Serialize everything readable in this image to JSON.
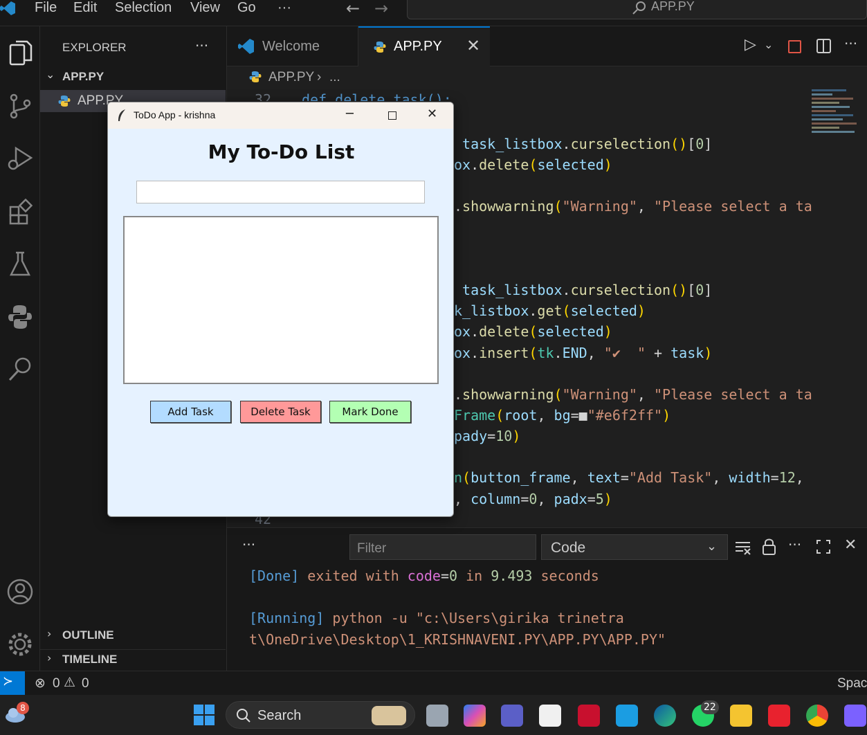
{
  "menu": {
    "file": "File",
    "edit": "Edit",
    "selection": "Selection",
    "view": "View",
    "go": "Go",
    "more": "···"
  },
  "search": {
    "label": "APP.PY"
  },
  "sidebar": {
    "title": "EXPLORER",
    "more": "···",
    "folder": "APP.PY",
    "file": "APP.PY",
    "outline": "OUTLINE",
    "timeline": "TIMELINE"
  },
  "tabs": {
    "welcome": "Welcome",
    "active": "APP.PY"
  },
  "breadcrumb": {
    "file": "APP.PY",
    "rest": "..."
  },
  "editor": {
    "line_top_num": "32",
    "line_top_text": "def delete_task():",
    "line_bottom_num": "42",
    "lines": [
      {
        "parts": [
          [
            "v",
            " task_listbox"
          ],
          [
            "p",
            "."
          ],
          [
            "f",
            "curselection"
          ],
          [
            "y",
            "()"
          ],
          [
            "p",
            "["
          ],
          [
            "n",
            "0"
          ],
          [
            "p",
            "]"
          ]
        ]
      },
      {
        "parts": [
          [
            "v",
            "ox"
          ],
          [
            "p",
            "."
          ],
          [
            "f",
            "delete"
          ],
          [
            "y",
            "("
          ],
          [
            "v",
            "selected"
          ],
          [
            "y",
            ")"
          ]
        ]
      },
      {
        "parts": []
      },
      {
        "parts": [
          [
            "p",
            "."
          ],
          [
            "f",
            "showwarning"
          ],
          [
            "y",
            "("
          ],
          [
            "s",
            "\"Warning\""
          ],
          [
            "p",
            ", "
          ],
          [
            "s",
            "\"Please select a ta"
          ]
        ]
      },
      {
        "parts": []
      },
      {
        "parts": []
      },
      {
        "parts": []
      },
      {
        "parts": [
          [
            "v",
            " task_listbox"
          ],
          [
            "p",
            "."
          ],
          [
            "f",
            "curselection"
          ],
          [
            "y",
            "()"
          ],
          [
            "p",
            "["
          ],
          [
            "n",
            "0"
          ],
          [
            "p",
            "]"
          ]
        ]
      },
      {
        "parts": [
          [
            "v",
            "k_listbox"
          ],
          [
            "p",
            "."
          ],
          [
            "f",
            "get"
          ],
          [
            "y",
            "("
          ],
          [
            "v",
            "selected"
          ],
          [
            "y",
            ")"
          ]
        ]
      },
      {
        "parts": [
          [
            "v",
            "ox"
          ],
          [
            "p",
            "."
          ],
          [
            "f",
            "delete"
          ],
          [
            "y",
            "("
          ],
          [
            "v",
            "selected"
          ],
          [
            "y",
            ")"
          ]
        ]
      },
      {
        "parts": [
          [
            "v",
            "ox"
          ],
          [
            "p",
            "."
          ],
          [
            "f",
            "insert"
          ],
          [
            "y",
            "("
          ],
          [
            "t",
            "tk"
          ],
          [
            "p",
            "."
          ],
          [
            "v",
            "END"
          ],
          [
            "p",
            ", "
          ],
          [
            "s",
            "\"✔  \""
          ],
          [
            "p",
            " + "
          ],
          [
            "v",
            "task"
          ],
          [
            "y",
            ")"
          ]
        ]
      },
      {
        "parts": []
      },
      {
        "parts": [
          [
            "p",
            "."
          ],
          [
            "f",
            "showwarning"
          ],
          [
            "y",
            "("
          ],
          [
            "s",
            "\"Warning\""
          ],
          [
            "p",
            ", "
          ],
          [
            "s",
            "\"Please select a ta"
          ]
        ]
      },
      {
        "parts": [
          [
            "t",
            "Frame"
          ],
          [
            "y",
            "("
          ],
          [
            "v",
            "root"
          ],
          [
            "p",
            ", "
          ],
          [
            "v",
            "bg"
          ],
          [
            "p",
            "="
          ],
          [
            "p",
            "■"
          ],
          [
            "s",
            "\"#e6f2ff\""
          ],
          [
            "y",
            ")"
          ]
        ]
      },
      {
        "parts": [
          [
            "v",
            "pady"
          ],
          [
            "p",
            "="
          ],
          [
            "n",
            "10"
          ],
          [
            "y",
            ")"
          ]
        ]
      },
      {
        "parts": []
      },
      {
        "parts": [
          [
            "t",
            "n"
          ],
          [
            "y",
            "("
          ],
          [
            "v",
            "button_frame"
          ],
          [
            "p",
            ", "
          ],
          [
            "v",
            "text"
          ],
          [
            "p",
            "="
          ],
          [
            "s",
            "\"Add Task\""
          ],
          [
            "p",
            ", "
          ],
          [
            "v",
            "width"
          ],
          [
            "p",
            "="
          ],
          [
            "n",
            "12"
          ],
          [
            "p",
            ","
          ]
        ]
      },
      {
        "parts": [
          [
            "p",
            ", "
          ],
          [
            "v",
            "column"
          ],
          [
            "p",
            "="
          ],
          [
            "n",
            "0"
          ],
          [
            "p",
            ", "
          ],
          [
            "v",
            "padx"
          ],
          [
            "p",
            "="
          ],
          [
            "n",
            "5"
          ],
          [
            "y",
            ")"
          ]
        ]
      }
    ]
  },
  "panel": {
    "more": "···",
    "filter_placeholder": "Filter",
    "dropdown_value": "Code",
    "output": [
      {
        "parts": [
          [
            "k",
            "[Done]"
          ],
          [
            "s",
            " exited with "
          ],
          [
            "pu",
            "code"
          ],
          [
            "p",
            "="
          ],
          [
            "n",
            "0"
          ],
          [
            "s",
            " in "
          ],
          [
            "n",
            "9.493"
          ],
          [
            "s",
            " seconds"
          ]
        ]
      },
      {
        "parts": []
      },
      {
        "parts": [
          [
            "k",
            "[Running]"
          ],
          [
            "s",
            " python -u \"c:\\Users\\girika trinetra"
          ]
        ]
      },
      {
        "parts": [
          [
            "s",
            "t\\OneDrive\\Desktop\\1_KRISHNAVENI.PY\\APP.PY\\APP.PY\""
          ]
        ]
      }
    ]
  },
  "status": {
    "errors": "0",
    "warnings": "0",
    "right": "Spac"
  },
  "taskbar": {
    "search": "Search",
    "weather_badge": "8",
    "whatsapp_badge": "22"
  },
  "tk": {
    "title": "ToDo App - krishna",
    "heading": "My To-Do List",
    "entry_value": "",
    "add": "Add Task",
    "delete": "Delete Task",
    "done": "Mark Done",
    "colors": {
      "bg": "#e6f2ff",
      "add": "#b3dcff",
      "delete": "#ff9999",
      "done": "#b3ffb3"
    }
  }
}
